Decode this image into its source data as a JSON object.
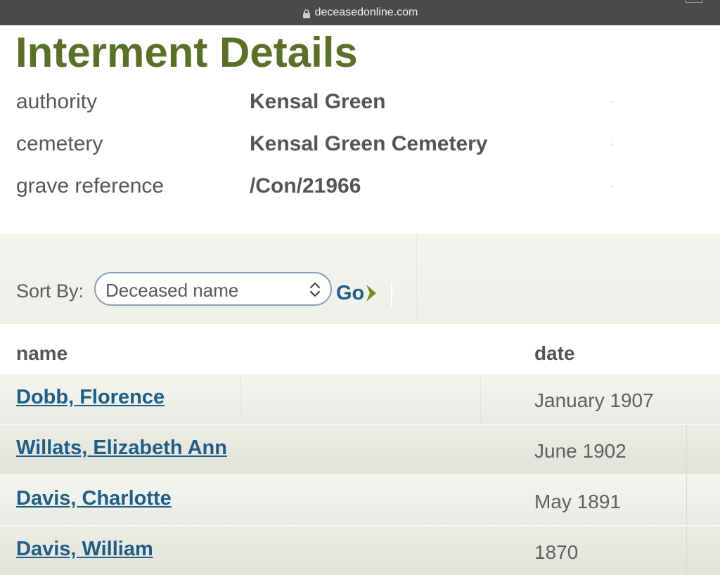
{
  "browser": {
    "url": "deceasedonline.com"
  },
  "page": {
    "title": "Interment Details"
  },
  "details": [
    {
      "label": "authority",
      "value": "Kensal Green"
    },
    {
      "label": "cemetery",
      "value": "Kensal Green Cemetery"
    },
    {
      "label": "grave reference",
      "value": "/Con/21966"
    }
  ],
  "sort": {
    "label": "Sort By:",
    "selected": "Deceased name",
    "go_label": "Go"
  },
  "table": {
    "headers": {
      "name": "name",
      "date": "date"
    },
    "rows": [
      {
        "name": "Dobb, Florence",
        "date": "January 1907"
      },
      {
        "name": "Willats, Elizabeth Ann",
        "date": "June 1902"
      },
      {
        "name": "Davis, Charlotte",
        "date": "May 1891"
      },
      {
        "name": "Davis, William",
        "date": "1870"
      }
    ]
  },
  "colors": {
    "title": "#5a6f27",
    "link": "#1f5d86",
    "go_arrow": "#6f8f2a",
    "url_bar": "#4a4a4a"
  }
}
